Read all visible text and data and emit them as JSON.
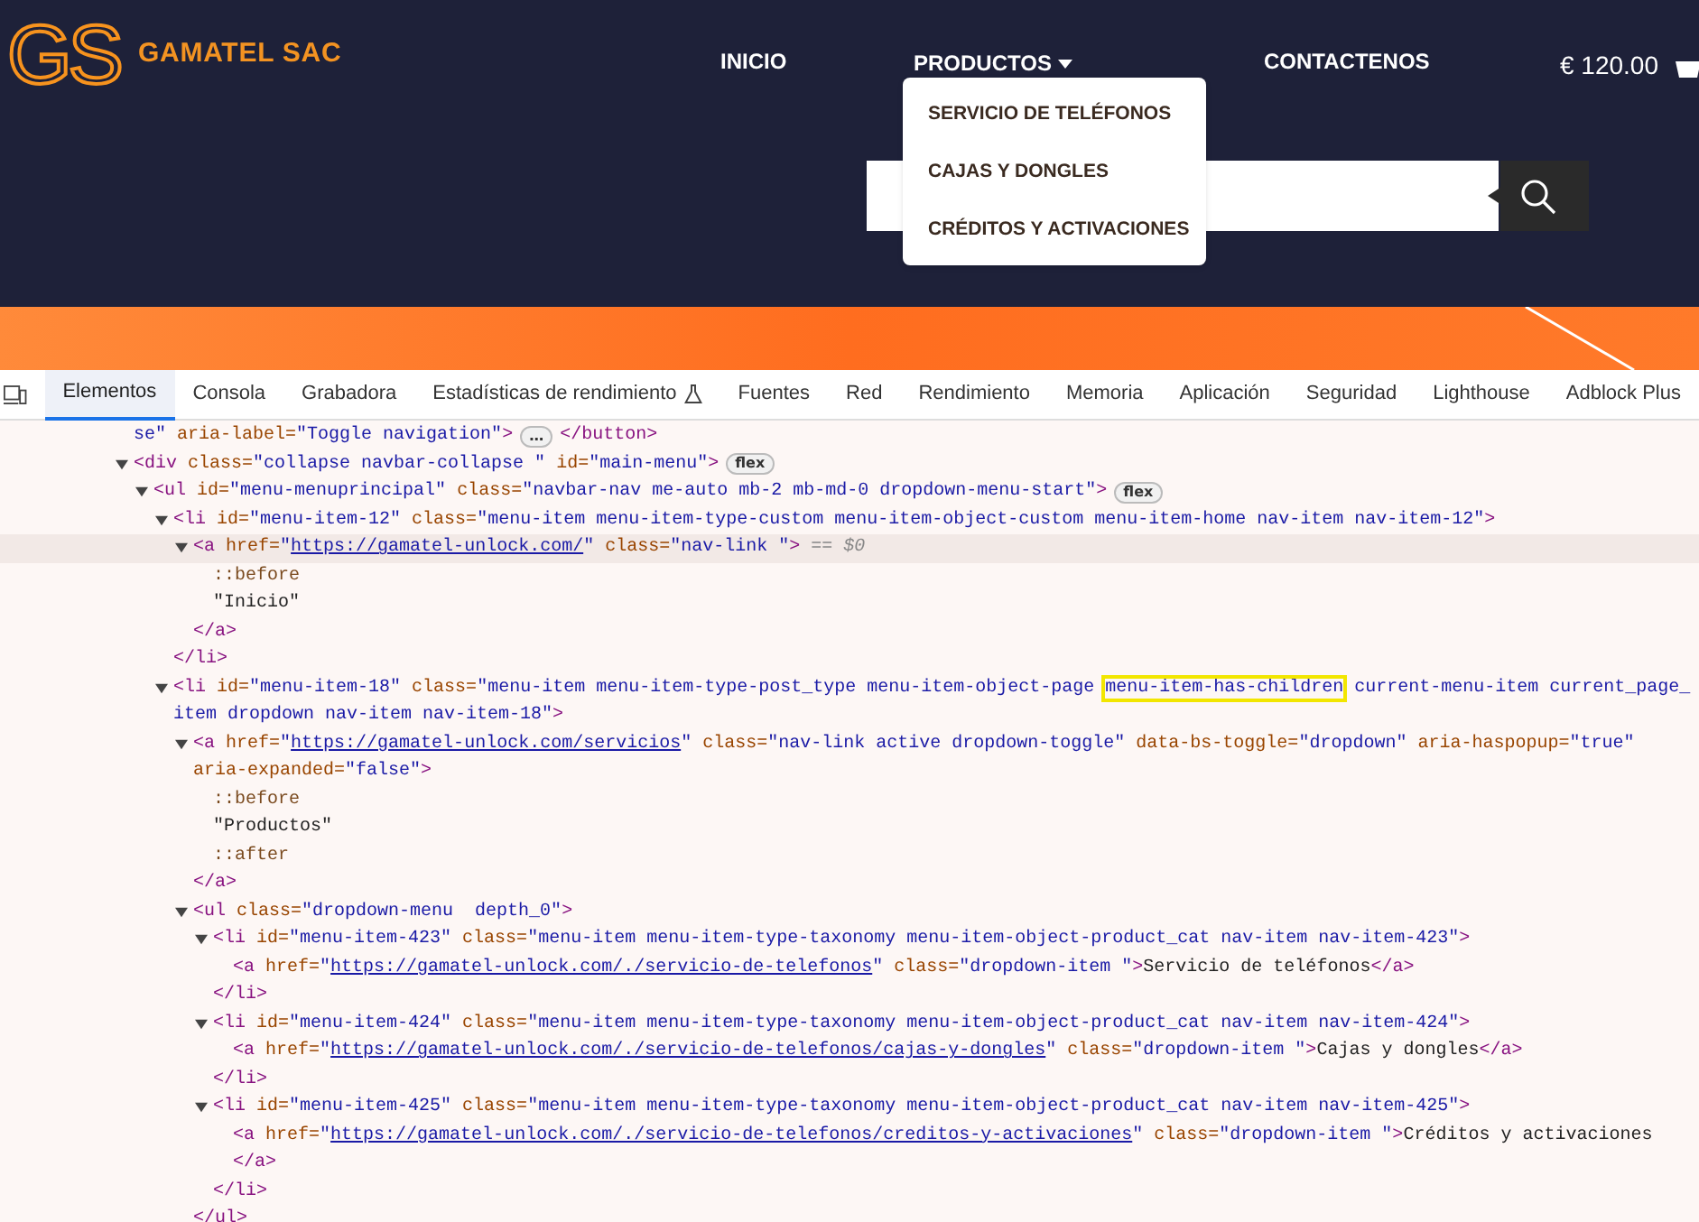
{
  "site": {
    "logo_text": "GS",
    "brand": "GAMATEL SAC",
    "nav": [
      {
        "label": "INICIO",
        "dropdown": false
      },
      {
        "label": "PRODUCTOS",
        "dropdown": true,
        "expanded": true
      },
      {
        "label": "CONTACTENOS",
        "dropdown": false
      }
    ],
    "dropdown_items": [
      "SERVICIO DE TELÉFONOS",
      "CAJAS Y DONGLES",
      "CRÉDITOS Y ACTIVACIONES"
    ],
    "cart_total": "€ 120.00"
  },
  "devtools": {
    "tabs": [
      {
        "label": "Elementos",
        "selected": true,
        "icon": false
      },
      {
        "label": "Consola",
        "selected": false,
        "icon": false
      },
      {
        "label": "Grabadora",
        "selected": false,
        "icon": false
      },
      {
        "label": "Estadísticas de rendimiento",
        "selected": false,
        "icon": true
      },
      {
        "label": "Fuentes",
        "selected": false,
        "icon": false
      },
      {
        "label": "Red",
        "selected": false,
        "icon": false
      },
      {
        "label": "Rendimiento",
        "selected": false,
        "icon": false
      },
      {
        "label": "Memoria",
        "selected": false,
        "icon": false
      },
      {
        "label": "Aplicación",
        "selected": false,
        "icon": false
      },
      {
        "label": "Seguridad",
        "selected": false,
        "icon": false
      },
      {
        "label": "Lighthouse",
        "selected": false,
        "icon": false
      },
      {
        "label": "Adblock Plus",
        "selected": false,
        "icon": false
      }
    ],
    "dom": [
      {
        "selected": false,
        "lines": [
          [
            {
              "kind": "val",
              "s": "se\""
            },
            {
              "kind": "attr",
              "s": " aria-label="
            },
            {
              "kind": "val",
              "s": "\"Toggle navigation\""
            },
            {
              "kind": "tag",
              "s": ">"
            },
            {
              "kind": "badge",
              "s": "…"
            },
            {
              "kind": "tag",
              "s": "</button>"
            }
          ]
        ]
      },
      {
        "selected": false,
        "expanded": true,
        "lines": [
          [
            {
              "kind": "tag",
              "s": "<div"
            },
            {
              "kind": "attr",
              "s": " class="
            },
            {
              "kind": "val",
              "s": "\"collapse navbar-collapse \""
            },
            {
              "kind": "attr",
              "s": " id="
            },
            {
              "kind": "val",
              "s": "\"main-menu\""
            },
            {
              "kind": "tag",
              "s": ">"
            },
            {
              "kind": "badge",
              "s": "flex"
            }
          ]
        ],
        "children": [
          {
            "selected": false,
            "expanded": true,
            "lines": [
              [
                {
                  "kind": "tag",
                  "s": "<ul"
                },
                {
                  "kind": "attr",
                  "s": " id="
                },
                {
                  "kind": "val",
                  "s": "\"menu-menuprincipal\""
                },
                {
                  "kind": "attr",
                  "s": " class="
                },
                {
                  "kind": "val",
                  "s": "\"navbar-nav me-auto mb-2 mb-md-0 dropdown-menu-start\""
                },
                {
                  "kind": "tag",
                  "s": ">"
                },
                {
                  "kind": "badge",
                  "s": "flex"
                }
              ]
            ],
            "children": [
              {
                "selected": false,
                "expanded": true,
                "closing": "</li>",
                "lines": [
                  [
                    {
                      "kind": "tag",
                      "s": "<li"
                    },
                    {
                      "kind": "attr",
                      "s": " id="
                    },
                    {
                      "kind": "val",
                      "s": "\"menu-item-12\""
                    },
                    {
                      "kind": "attr",
                      "s": " class="
                    },
                    {
                      "kind": "val",
                      "s": "\"menu-item menu-item-type-custom menu-item-object-custom menu-item-home nav-item nav-item-12\""
                    },
                    {
                      "kind": "tag",
                      "s": ">"
                    }
                  ]
                ],
                "children": [
                  {
                    "selected": true,
                    "expanded": true,
                    "closing": "</a>",
                    "lines": [
                      [
                        {
                          "kind": "tag",
                          "s": "<a"
                        },
                        {
                          "kind": "attr",
                          "s": " href="
                        },
                        {
                          "kind": "val",
                          "s": "\""
                        },
                        {
                          "kind": "link",
                          "s": "https://gamatel-unlock.com/"
                        },
                        {
                          "kind": "val",
                          "s": "\""
                        },
                        {
                          "kind": "attr",
                          "s": " class="
                        },
                        {
                          "kind": "val",
                          "s": "\"nav-link \""
                        },
                        {
                          "kind": "tag",
                          "s": ">"
                        },
                        {
                          "kind": "note",
                          "s": " == $0"
                        }
                      ]
                    ],
                    "children": [
                      {
                        "selected": false,
                        "lines": [
                          [
                            {
                              "kind": "pseudo",
                              "s": "::before"
                            }
                          ]
                        ]
                      },
                      {
                        "selected": false,
                        "lines": [
                          [
                            {
                              "kind": "text",
                              "s": "\"Inicio\""
                            }
                          ]
                        ]
                      }
                    ]
                  }
                ]
              },
              {
                "selected": false,
                "expanded": true,
                "lines": [
                  [
                    {
                      "kind": "tag",
                      "s": "<li"
                    },
                    {
                      "kind": "attr",
                      "s": " id="
                    },
                    {
                      "kind": "val",
                      "s": "\"menu-item-18\""
                    },
                    {
                      "kind": "attr",
                      "s": " class="
                    },
                    {
                      "kind": "val",
                      "s": "\"menu-item menu-item-type-post_type menu-item-object-page "
                    },
                    {
                      "kind": "hl",
                      "s": "menu-item-has-children"
                    },
                    {
                      "kind": "val",
                      "s": " current-menu-item current_page_"
                    }
                  ],
                  [
                    {
                      "kind": "val",
                      "s": "item dropdown nav-item nav-item-18\""
                    },
                    {
                      "kind": "tag",
                      "s": ">"
                    }
                  ]
                ],
                "children": [
                  {
                    "selected": false,
                    "expanded": true,
                    "closing": "</a>",
                    "lines": [
                      [
                        {
                          "kind": "tag",
                          "s": "<a"
                        },
                        {
                          "kind": "attr",
                          "s": " href="
                        },
                        {
                          "kind": "val",
                          "s": "\""
                        },
                        {
                          "kind": "link",
                          "s": "https://gamatel-unlock.com/servicios"
                        },
                        {
                          "kind": "val",
                          "s": "\""
                        },
                        {
                          "kind": "attr",
                          "s": " class="
                        },
                        {
                          "kind": "val",
                          "s": "\"nav-link active dropdown-toggle\""
                        },
                        {
                          "kind": "attr",
                          "s": " data-bs-toggle="
                        },
                        {
                          "kind": "val",
                          "s": "\"dropdown\""
                        },
                        {
                          "kind": "attr",
                          "s": " aria-haspopup="
                        },
                        {
                          "kind": "val",
                          "s": "\"true\""
                        }
                      ],
                      [
                        {
                          "kind": "attr",
                          "s": "aria-expanded="
                        },
                        {
                          "kind": "val",
                          "s": "\"false\""
                        },
                        {
                          "kind": "tag",
                          "s": ">"
                        }
                      ]
                    ],
                    "children": [
                      {
                        "selected": false,
                        "lines": [
                          [
                            {
                              "kind": "pseudo",
                              "s": "::before"
                            }
                          ]
                        ]
                      },
                      {
                        "selected": false,
                        "lines": [
                          [
                            {
                              "kind": "text",
                              "s": "\"Productos\""
                            }
                          ]
                        ]
                      },
                      {
                        "selected": false,
                        "lines": [
                          [
                            {
                              "kind": "pseudo",
                              "s": "::after"
                            }
                          ]
                        ]
                      }
                    ]
                  },
                  {
                    "selected": false,
                    "expanded": true,
                    "closing": "</ul>",
                    "lines": [
                      [
                        {
                          "kind": "tag",
                          "s": "<ul"
                        },
                        {
                          "kind": "attr",
                          "s": " class="
                        },
                        {
                          "kind": "val",
                          "s": "\"dropdown-menu  depth_0\""
                        },
                        {
                          "kind": "tag",
                          "s": ">"
                        }
                      ]
                    ],
                    "children": [
                      {
                        "selected": false,
                        "expanded": true,
                        "closing": "</li>",
                        "lines": [
                          [
                            {
                              "kind": "tag",
                              "s": "<li"
                            },
                            {
                              "kind": "attr",
                              "s": " id="
                            },
                            {
                              "kind": "val",
                              "s": "\"menu-item-423\""
                            },
                            {
                              "kind": "attr",
                              "s": " class="
                            },
                            {
                              "kind": "val",
                              "s": "\"menu-item menu-item-type-taxonomy menu-item-object-product_cat nav-item nav-item-423\""
                            },
                            {
                              "kind": "tag",
                              "s": ">"
                            }
                          ]
                        ],
                        "children": [
                          {
                            "selected": false,
                            "lines": [
                              [
                                {
                                  "kind": "tag",
                                  "s": "<a"
                                },
                                {
                                  "kind": "attr",
                                  "s": " href="
                                },
                                {
                                  "kind": "val",
                                  "s": "\""
                                },
                                {
                                  "kind": "link",
                                  "s": "https://gamatel-unlock.com/./servicio-de-telefonos"
                                },
                                {
                                  "kind": "val",
                                  "s": "\""
                                },
                                {
                                  "kind": "attr",
                                  "s": " class="
                                },
                                {
                                  "kind": "val",
                                  "s": "\"dropdown-item \""
                                },
                                {
                                  "kind": "tag",
                                  "s": ">"
                                },
                                {
                                  "kind": "text",
                                  "s": "Servicio de teléfonos"
                                },
                                {
                                  "kind": "tag",
                                  "s": "</a>"
                                }
                              ]
                            ]
                          }
                        ]
                      },
                      {
                        "selected": false,
                        "expanded": true,
                        "closing": "</li>",
                        "lines": [
                          [
                            {
                              "kind": "tag",
                              "s": "<li"
                            },
                            {
                              "kind": "attr",
                              "s": " id="
                            },
                            {
                              "kind": "val",
                              "s": "\"menu-item-424\""
                            },
                            {
                              "kind": "attr",
                              "s": " class="
                            },
                            {
                              "kind": "val",
                              "s": "\"menu-item menu-item-type-taxonomy menu-item-object-product_cat nav-item nav-item-424\""
                            },
                            {
                              "kind": "tag",
                              "s": ">"
                            }
                          ]
                        ],
                        "children": [
                          {
                            "selected": false,
                            "lines": [
                              [
                                {
                                  "kind": "tag",
                                  "s": "<a"
                                },
                                {
                                  "kind": "attr",
                                  "s": " href="
                                },
                                {
                                  "kind": "val",
                                  "s": "\""
                                },
                                {
                                  "kind": "link",
                                  "s": "https://gamatel-unlock.com/./servicio-de-telefonos/cajas-y-dongles"
                                },
                                {
                                  "kind": "val",
                                  "s": "\""
                                },
                                {
                                  "kind": "attr",
                                  "s": " class="
                                },
                                {
                                  "kind": "val",
                                  "s": "\"dropdown-item \""
                                },
                                {
                                  "kind": "tag",
                                  "s": ">"
                                },
                                {
                                  "kind": "text",
                                  "s": "Cajas y dongles"
                                },
                                {
                                  "kind": "tag",
                                  "s": "</a>"
                                }
                              ]
                            ]
                          }
                        ]
                      },
                      {
                        "selected": false,
                        "expanded": true,
                        "closing": "</li>",
                        "lines": [
                          [
                            {
                              "kind": "tag",
                              "s": "<li"
                            },
                            {
                              "kind": "attr",
                              "s": " id="
                            },
                            {
                              "kind": "val",
                              "s": "\"menu-item-425\""
                            },
                            {
                              "kind": "attr",
                              "s": " class="
                            },
                            {
                              "kind": "val",
                              "s": "\"menu-item menu-item-type-taxonomy menu-item-object-product_cat nav-item nav-item-425\""
                            },
                            {
                              "kind": "tag",
                              "s": ">"
                            }
                          ]
                        ],
                        "children": [
                          {
                            "selected": false,
                            "closing": "</a>",
                            "lines": [
                              [
                                {
                                  "kind": "tag",
                                  "s": "<a"
                                },
                                {
                                  "kind": "attr",
                                  "s": " href="
                                },
                                {
                                  "kind": "val",
                                  "s": "\""
                                },
                                {
                                  "kind": "link",
                                  "s": "https://gamatel-unlock.com/./servicio-de-telefonos/creditos-y-activaciones"
                                },
                                {
                                  "kind": "val",
                                  "s": "\""
                                },
                                {
                                  "kind": "attr",
                                  "s": " class="
                                },
                                {
                                  "kind": "val",
                                  "s": "\"dropdown-item \""
                                },
                                {
                                  "kind": "tag",
                                  "s": ">"
                                },
                                {
                                  "kind": "text",
                                  "s": "Créditos y activaciones"
                                }
                              ]
                            ]
                          }
                        ]
                      }
                    ]
                  }
                ]
              }
            ]
          }
        ]
      }
    ]
  }
}
